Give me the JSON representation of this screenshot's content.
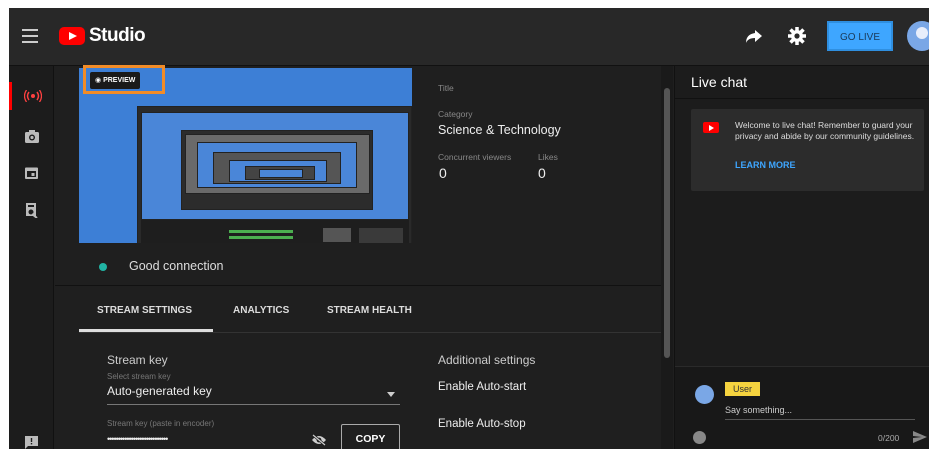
{
  "header": {
    "app_name": "Studio",
    "go_live_label": "GO LIVE"
  },
  "nav": {
    "items": [
      "live-icon",
      "camera-icon",
      "calendar-icon",
      "manage-icon"
    ],
    "feedback_icon": "feedback-icon"
  },
  "preview": {
    "badge_label": "PREVIEW",
    "connection_status": "Good connection"
  },
  "stream_info": {
    "title_label": "Title",
    "category_label": "Category",
    "category_value": "Science & Technology",
    "concurrent_label": "Concurrent viewers",
    "concurrent_value": "0",
    "likes_label": "Likes",
    "likes_value": "0"
  },
  "tabs": [
    "STREAM SETTINGS",
    "ANALYTICS",
    "STREAM HEALTH"
  ],
  "stream_settings": {
    "stream_key_title": "Stream key",
    "select_key_label": "Select stream key",
    "select_key_value": "Auto-generated key",
    "paste_label": "Stream key (paste in encoder)",
    "key_masked": "••••••••••••••••••••••••••••",
    "copy_label": "COPY",
    "additional_title": "Additional settings",
    "auto_start": "Enable Auto-start",
    "auto_stop": "Enable Auto-stop"
  },
  "chat": {
    "title": "Live chat",
    "welcome_text": "Welcome to live chat! Remember to guard your privacy and abide by our community guidelines.",
    "learn_more": "LEARN MORE",
    "user_badge": "User",
    "placeholder": "Say something...",
    "char_count": "0/200"
  },
  "colors": {
    "accent_red": "#ff0000",
    "go_live_blue": "#3ea6ff",
    "highlight_orange": "#f28c28",
    "connection_green": "#21b4a4"
  }
}
